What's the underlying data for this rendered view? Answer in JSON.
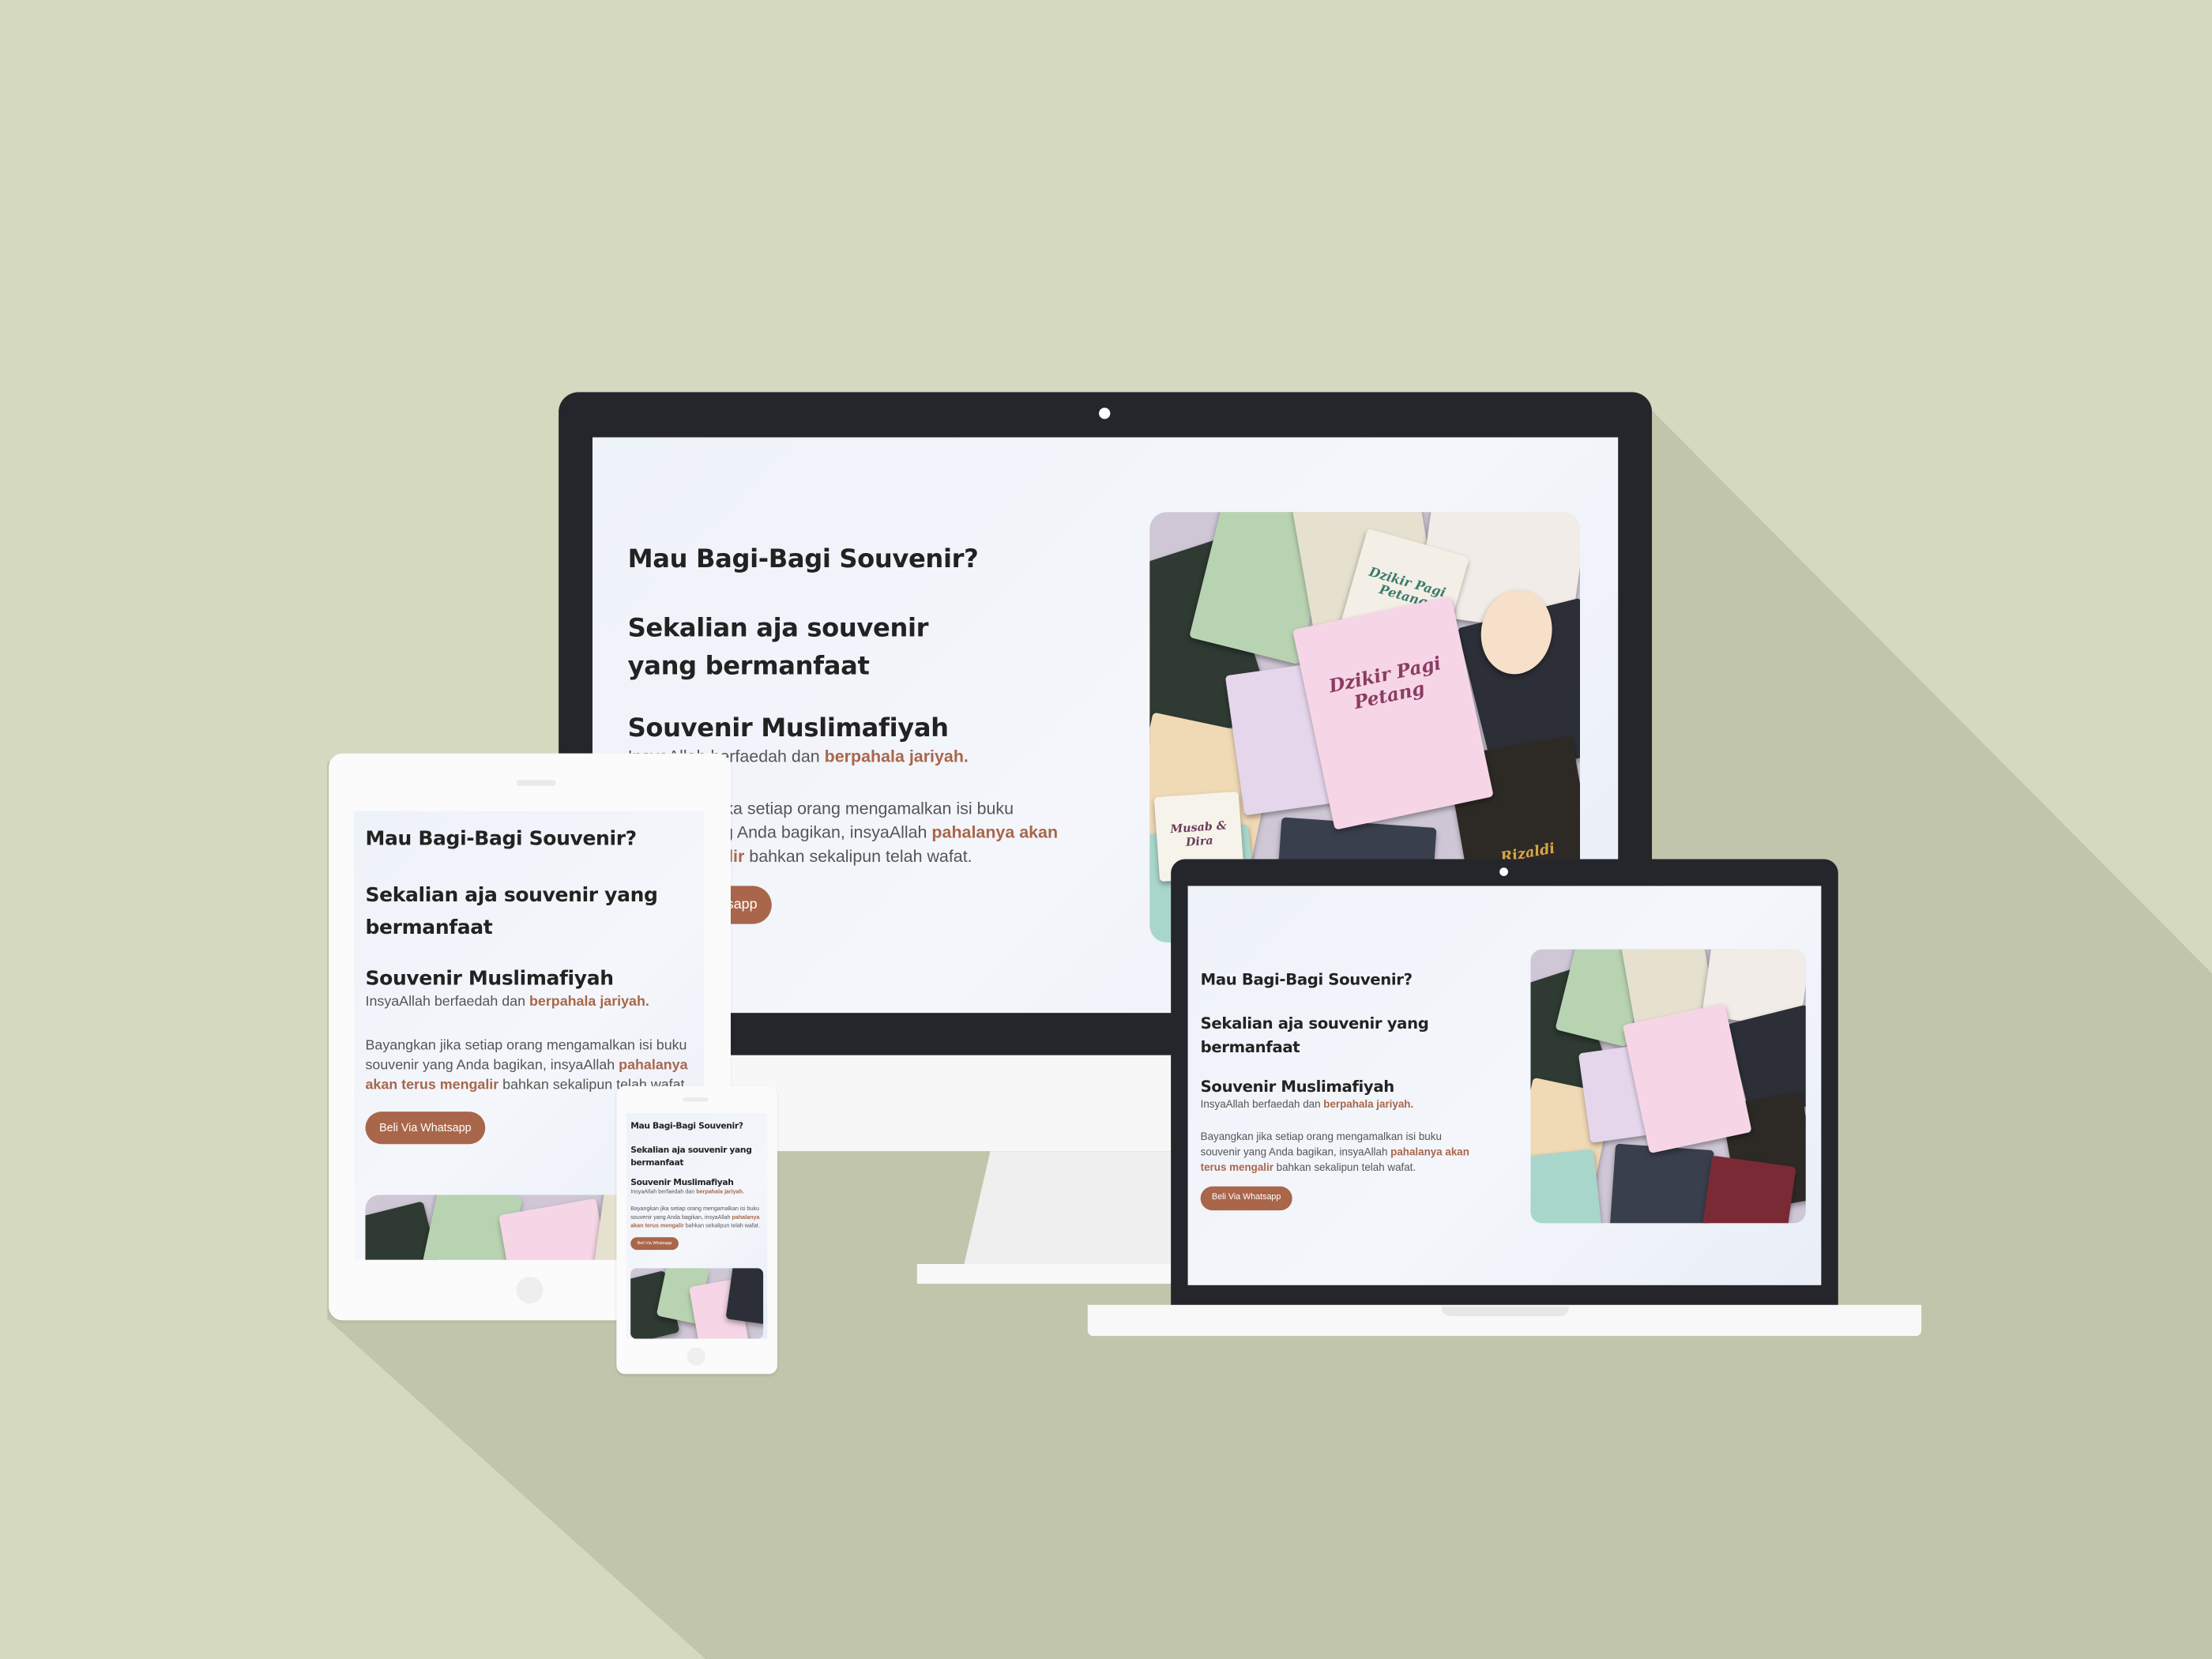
{
  "hero": {
    "headline": "Mau Bagi-Bagi Souvenir?",
    "subheadline": "Sekalian aja souvenir yang bermanfaat",
    "product_name": "Souvenir Muslimafiyah",
    "tagline_prefix": "InsyaAllah berfaedah dan ",
    "tagline_accent": "berpahala jariyah.",
    "body_prefix": "Bayangkan jika setiap orang mengamalkan isi buku souvenir yang Anda bagikan, insyaAllah ",
    "body_accent": "pahalanya akan terus mengalir",
    "body_suffix": " bahkan sekalipun telah wafat.",
    "cta_label": "Beli Via Whatsapp",
    "desktop_tagline_prefix": "I",
    "desktop_tagline_mid": "rfaedah dan ",
    "desktop_body_line1": "a setiap orang mengamalkan isi buku",
    "desktop_body_line2_prefix": "Anda bagikan, insyaAllah ",
    "desktop_body_line2_accent": "pahalanya akan",
    "desktop_body_line3_accent": "ir",
    "desktop_body_line3_suffix": " bahkan sekalipun telah wafat.",
    "desktop_cta_visible": "app"
  },
  "image": {
    "book_title_1": "Dzikir Pagi Petang",
    "book_title_2": "Dzikir Pagi Petang",
    "book_title_3": "Rizaldi",
    "book_title_4": "Musab & Dira"
  },
  "colors": {
    "background": "#d5d9bf",
    "accent": "#a9664a",
    "device_dark": "#25262b",
    "device_light": "#f8f8f8"
  }
}
